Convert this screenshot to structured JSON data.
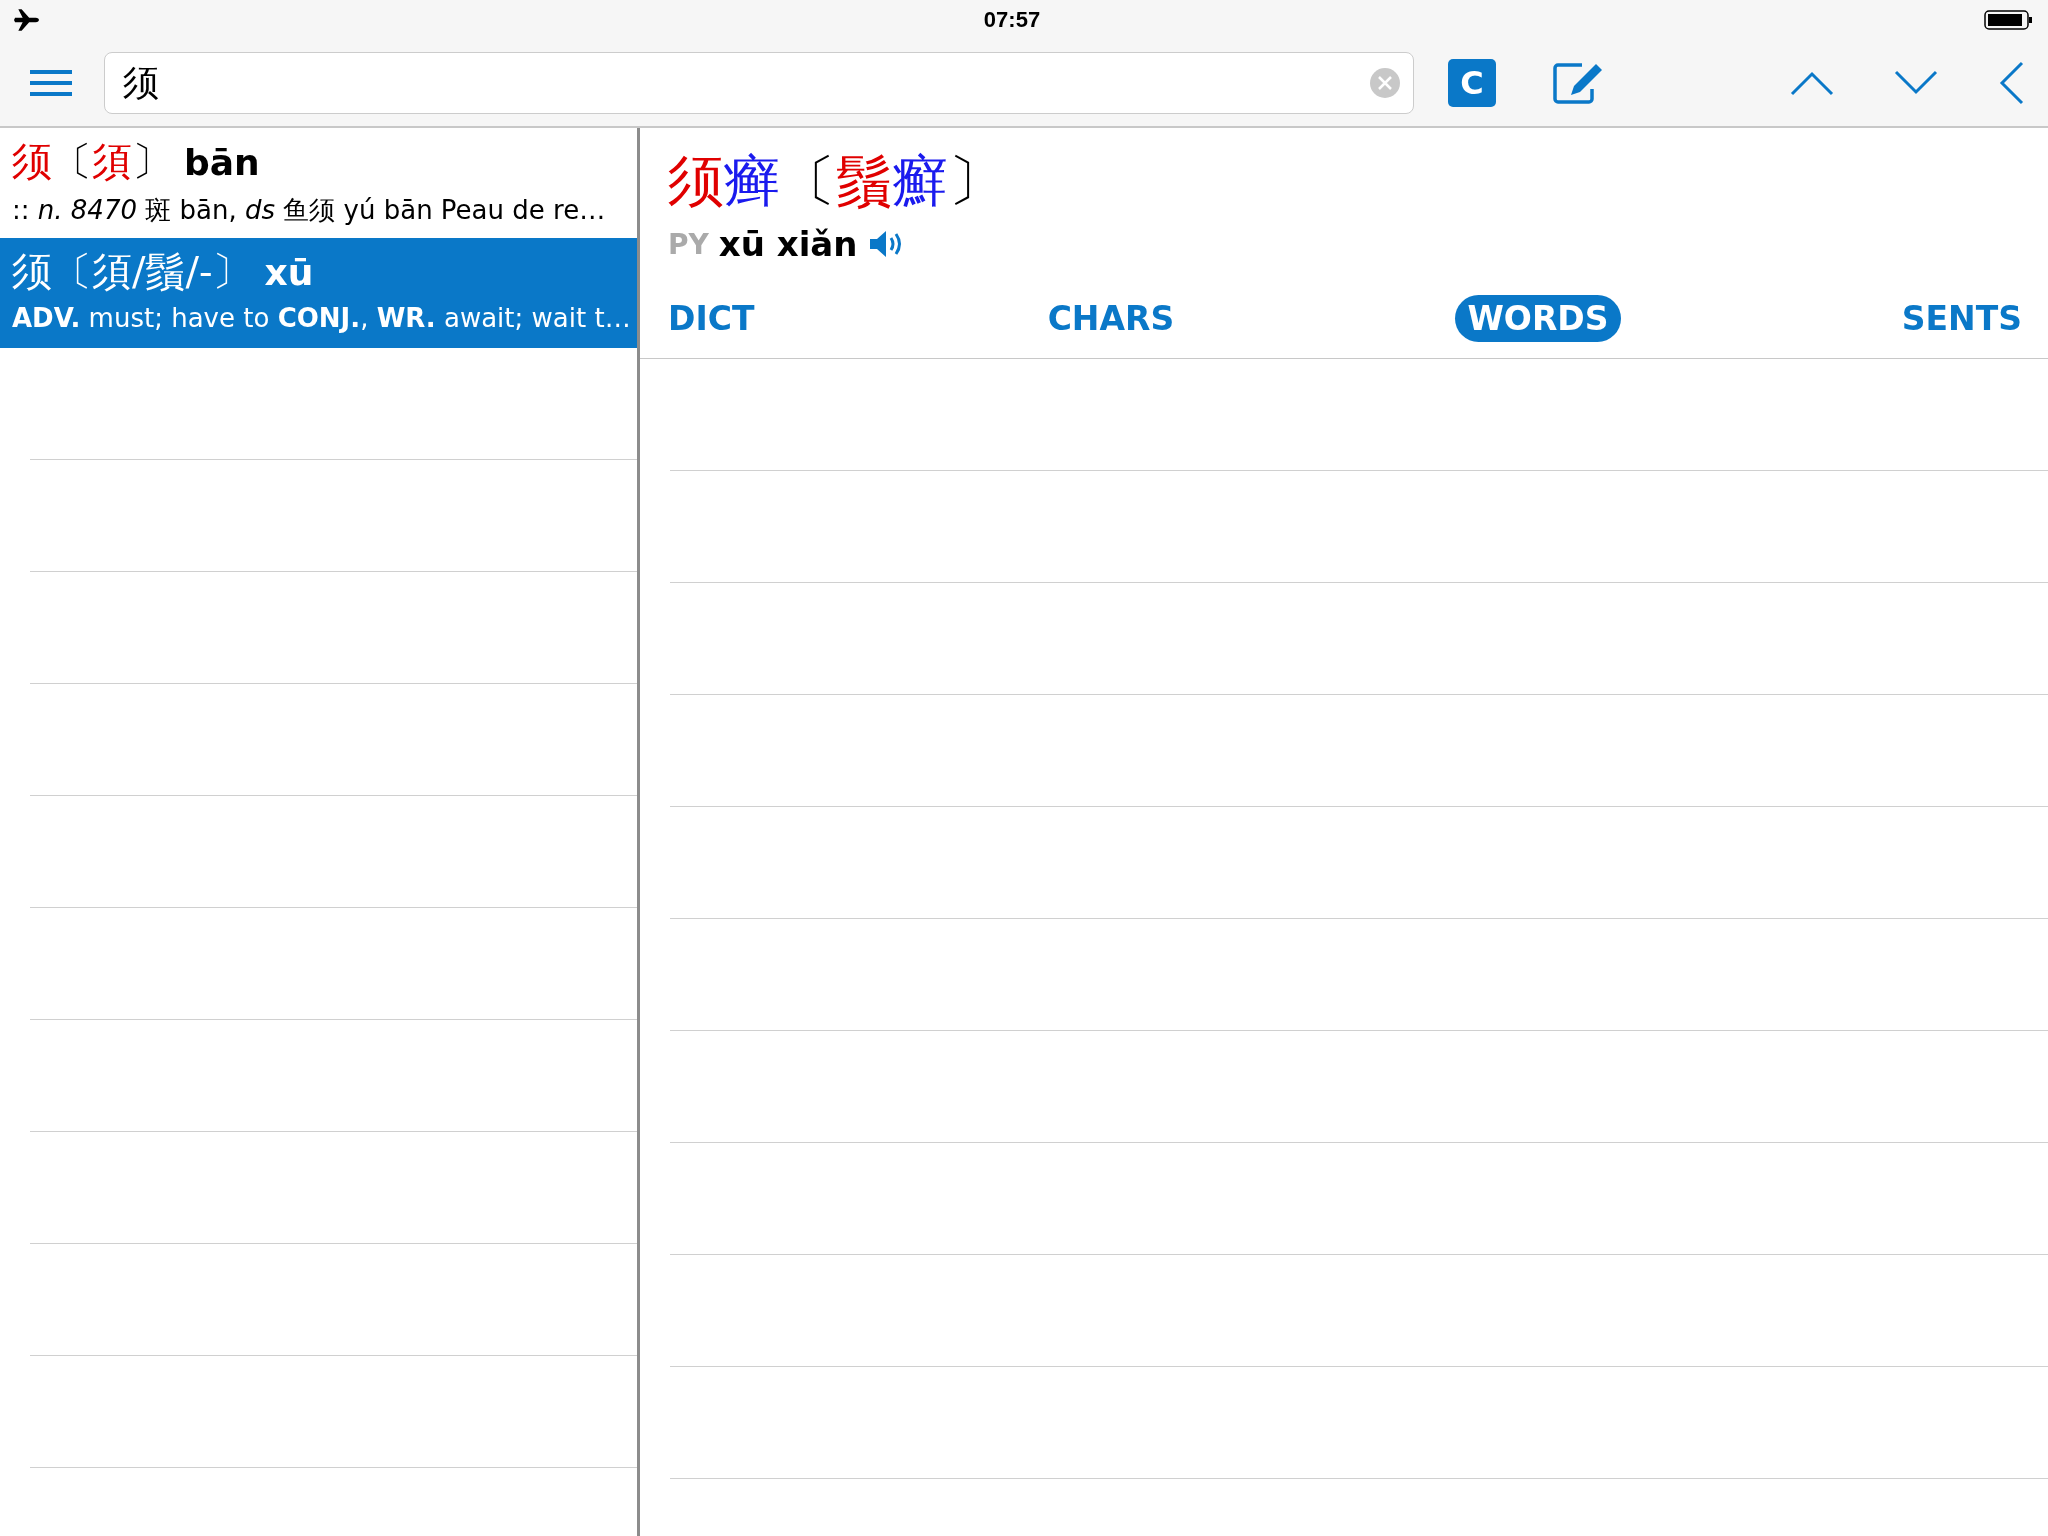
{
  "status_bar": {
    "time": "07:57"
  },
  "toolbar": {
    "search": {
      "value": "须"
    },
    "c_button": "C"
  },
  "results": [
    {
      "headword": [
        {
          "text": "须",
          "color": "#e00000"
        },
        {
          "text": "〔",
          "color": "#000000"
        },
        {
          "text": "須",
          "color": "#e00000"
        },
        {
          "text": "〕",
          "color": "#000000"
        }
      ],
      "pinyin": "bān",
      "definition": ":: *n. 8470* 斑 bān, *ds* 鱼须 yú bān Peau de re…",
      "selected": false
    },
    {
      "headword": [
        {
          "text": "须",
          "color": "#ffffff"
        },
        {
          "text": "〔",
          "color": "#ffffff"
        },
        {
          "text": "須/鬚/-",
          "color": "#ffffff"
        },
        {
          "text": "〕",
          "color": "#ffffff"
        }
      ],
      "pinyin": "xū",
      "definition": "**ADV.** must; have to  **CONJ.**, **WR.** await; wait t…",
      "selected": true
    }
  ],
  "entry": {
    "headword": [
      {
        "text": "须",
        "color": "#e00000"
      },
      {
        "text": "癣",
        "color": "#1a1aee"
      },
      {
        "text": "〔",
        "color": "#000000"
      },
      {
        "text": "鬚",
        "color": "#e00000"
      },
      {
        "text": "癬",
        "color": "#1a1aee"
      },
      {
        "text": "〕",
        "color": "#000000"
      }
    ],
    "py_label": "PY",
    "pinyin": "xū xiǎn",
    "tabs": [
      {
        "label": "DICT",
        "selected": false
      },
      {
        "label": "CHARS",
        "selected": false
      },
      {
        "label": "WORDS",
        "selected": true
      },
      {
        "label": "SENTS",
        "selected": false
      }
    ]
  }
}
